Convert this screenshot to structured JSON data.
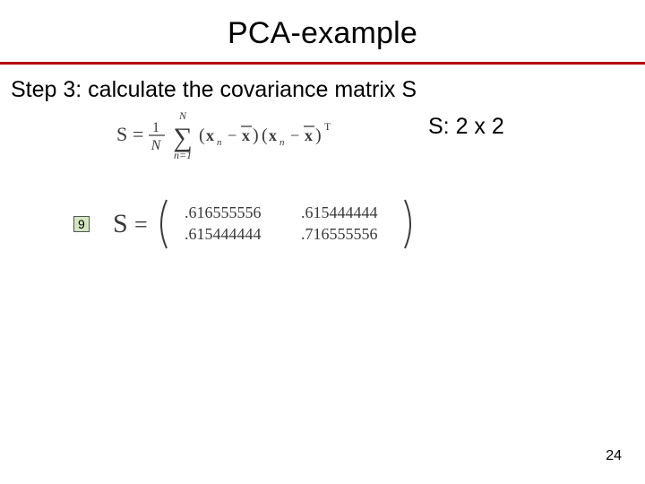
{
  "title": "PCA-example",
  "step": "Step 3: calculate the covariance matrix S",
  "size_label": "S: 2 x 2",
  "n_value": "9",
  "formula": {
    "lhs": "S",
    "eq": "=",
    "frac_num": "1",
    "frac_den": "N",
    "sum_top": "N",
    "sum_bot": "n=1",
    "term_open": "(",
    "xn": "x",
    "sub_n": "n",
    "minus": "−",
    "xbar": "x",
    "term_close": ")",
    "transpose": "T"
  },
  "matrix": {
    "lhs": "S",
    "eq": "=",
    "a11": ".616555556",
    "a12": ".615444444",
    "a21": ".615444444",
    "a22": ".716555556"
  },
  "page_number": "24"
}
